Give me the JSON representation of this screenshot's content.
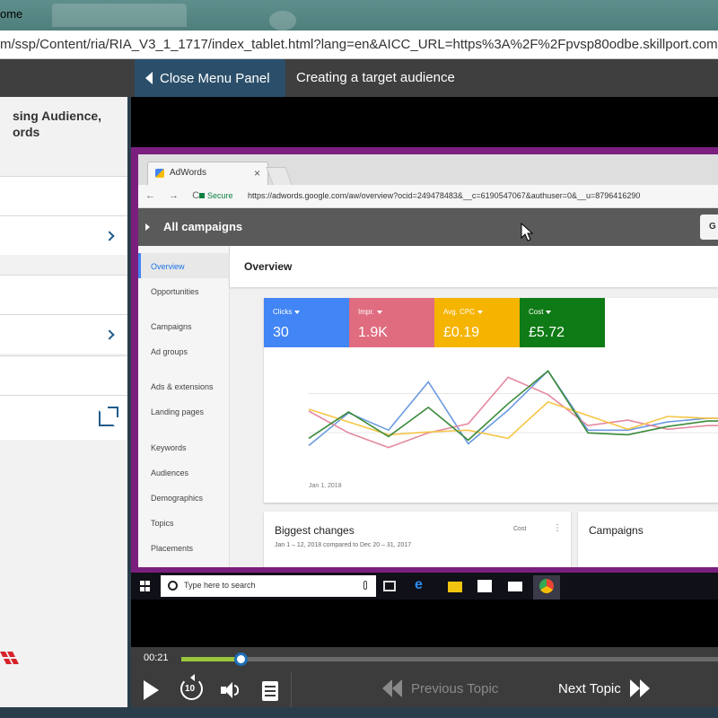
{
  "window": {
    "title_fragment": "ome"
  },
  "browser": {
    "url": "m/ssp/Content/ria/RIA_V3_1_1717/index_tablet.html?lang=en&AICC_URL=https%3A%2F%2Fpvsp80odbe.skillport.com"
  },
  "topnav": {
    "close_menu_label": "Close Menu Panel",
    "page_title": "Creating a target audience"
  },
  "sidebar": {
    "course_title_line1": "sing Audience,",
    "course_title_line2": "ords"
  },
  "inner_browser": {
    "tab_label": "AdWords",
    "tab_close": "×",
    "nav_icons": "← → C",
    "secure_label": "Secure",
    "url": "https://adwords.google.com/aw/overview?ocid=249478483&__c=6190547067&authuser=0&__u=8796416290"
  },
  "adwords": {
    "header_title": "All campaigns",
    "header_button": "G",
    "overview_title": "Overview",
    "nav": [
      "Overview",
      "Opportunities",
      "Campaigns",
      "Ad groups",
      "Ads & extensions",
      "Landing pages",
      "Keywords",
      "Audiences",
      "Demographics",
      "Topics",
      "Placements"
    ],
    "metrics": [
      {
        "label": "Clicks",
        "value": "30",
        "color": "#4285f4"
      },
      {
        "label": "Impr.",
        "value": "1.9K",
        "color": "#e06c80"
      },
      {
        "label": "Avg. CPC",
        "value": "£0.19",
        "color": "#f5b400"
      },
      {
        "label": "Cost",
        "value": "£5.72",
        "color": "#0f7b16"
      }
    ],
    "chart_date_label": "Jan 1, 2018",
    "biggest_changes_title": "Biggest changes",
    "biggest_changes_subtitle": "Jan 1 – 12, 2018 compared to Dec 20 – 31, 2017",
    "biggest_changes_metric": "Cost",
    "biggest_changes_menu": "⋮",
    "campaigns_title": "Campaigns"
  },
  "chart_data": {
    "type": "line",
    "x": [
      1,
      2,
      3,
      4,
      5,
      6,
      7,
      8,
      9,
      10,
      11,
      12
    ],
    "series": [
      {
        "name": "Clicks",
        "color": "#6b9be0",
        "values": [
          0.3,
          0.66,
          0.47,
          1.0,
          0.32,
          0.69,
          1.12,
          0.47,
          0.47,
          0.56,
          0.6,
          0.6
        ]
      },
      {
        "name": "Impr.",
        "color": "#e48aa0",
        "values": [
          0.68,
          0.44,
          0.28,
          0.44,
          0.54,
          1.05,
          0.86,
          0.52,
          0.58,
          0.48,
          0.52,
          0.52
        ]
      },
      {
        "name": "Avg. CPC",
        "color": "#f7c648",
        "values": [
          0.7,
          0.56,
          0.42,
          0.45,
          0.47,
          0.38,
          0.78,
          0.63,
          0.48,
          0.62,
          0.6,
          0.6
        ]
      },
      {
        "name": "Cost",
        "color": "#3b8a3a",
        "values": [
          0.38,
          0.67,
          0.4,
          0.72,
          0.36,
          0.76,
          1.12,
          0.44,
          0.42,
          0.51,
          0.57,
          0.57
        ]
      }
    ],
    "ylim": [
      0,
      1.3
    ]
  },
  "taskbar": {
    "search_placeholder": "Type here to search"
  },
  "player": {
    "time": "00:21",
    "progress": 0.11,
    "replay_label": "10",
    "previous_topic": "Previous Topic",
    "next_topic": "Next Topic"
  }
}
